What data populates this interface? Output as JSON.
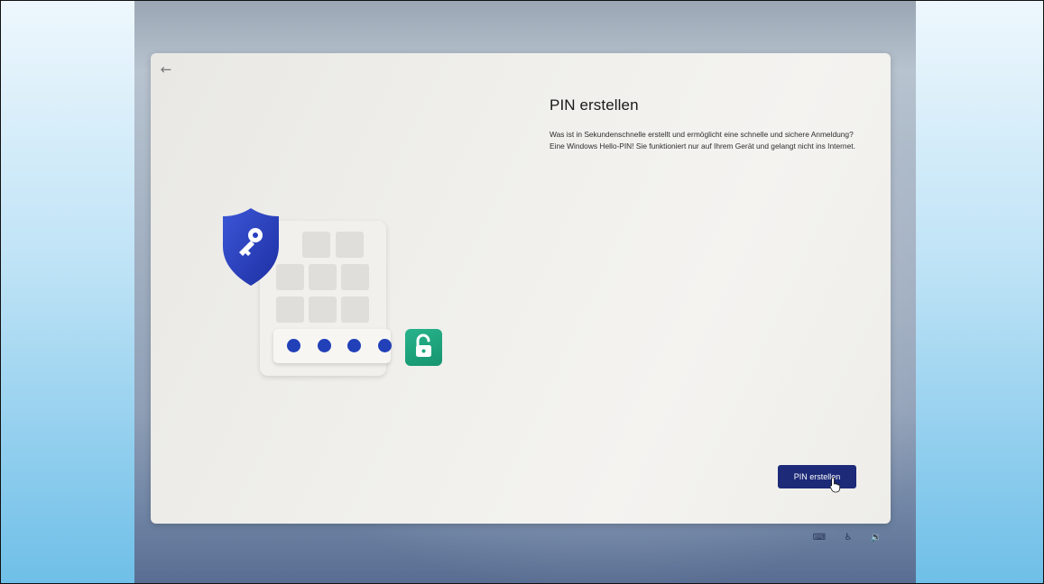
{
  "dialog": {
    "back_icon": "←",
    "title": "PIN erstellen",
    "description": "Was ist in Sekundenschnelle erstellt und ermöglicht eine schnelle und sichere Anmeldung? Eine Windows Hello-PIN! Sie funktioniert nur auf Ihrem Gerät und gelangt nicht ins Internet.",
    "primary_button_label": "PIN erstellen"
  },
  "illustration": {
    "shield_icon": "shield-key-icon",
    "lock_icon": "unlocked-padlock-icon",
    "pin_dots_count_shown": 4
  },
  "tray": {
    "keyboard_icon": "⌨",
    "accessibility_icon": "♿",
    "volume_icon": "🔉"
  },
  "colors": {
    "accent": "#1c2a78",
    "shield_blue": "#2a3fc0",
    "lock_green": "#1fa47e",
    "pin_dot": "#2240b8"
  }
}
